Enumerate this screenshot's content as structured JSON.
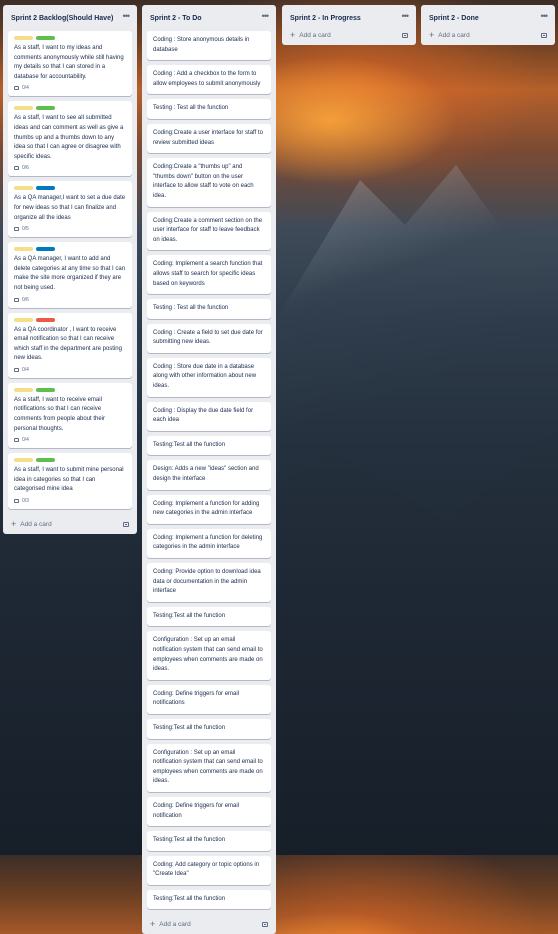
{
  "colors": {
    "label_yellow": "#f5dd8a",
    "label_green": "#61bd4f",
    "label_blue": "#0079bf",
    "label_red": "#eb5a46"
  },
  "lists": [
    {
      "title": "Sprint 2 Backlog(Should Have)",
      "add_card": "Add a card",
      "cards": [
        {
          "text": "As a staff, I want to my ideas and comments anonymously while still having my details so that I can stored in a database for accountability.",
          "labels": [
            "yellow",
            "green"
          ],
          "checklist": "0/4"
        },
        {
          "text": "As a staff, I want to see all submitted ideas and can comment as well as give a thumbs up and a thumbs down to any idea so that I can agree or disagree with specific ideas.",
          "labels": [
            "yellow",
            "green"
          ],
          "checklist": "0/6"
        },
        {
          "text": "As a QA manager,I want to set a due date for new ideas so that I can finalize and organize all the ideas",
          "labels": [
            "yellow",
            "blue"
          ],
          "checklist": "0/5"
        },
        {
          "text": "As a QA manager, I want to add and delete categories at any time so that I can make the site more organized if they are not being used.",
          "labels": [
            "yellow",
            "blue"
          ],
          "checklist": "0/6"
        },
        {
          "text": "As a QA coordinator , I want to receive email notification so that I can receive which staff in the department are posting new ideas.",
          "labels": [
            "yellow",
            "red"
          ],
          "checklist": "0/4"
        },
        {
          "text": "As a staff, I want to receive email notifications so that I can receive comments from people about their personal thoughts.",
          "labels": [
            "yellow",
            "green"
          ],
          "checklist": "0/4"
        },
        {
          "text": "As a staff, I want to submit mine personal idea in categories so that I can categorised mine idea",
          "labels": [
            "yellow",
            "green"
          ],
          "checklist": "0/3"
        }
      ]
    },
    {
      "title": "Sprint 2 - To Do",
      "add_card": "Add a card",
      "cards": [
        {
          "text": "Coding : Store anonymous details in database"
        },
        {
          "text": "Coding : Add a checkbox to the form to allow employees to submit anonymously"
        },
        {
          "text": "Testing : Test all the function"
        },
        {
          "text": "Coding:Create a user interface for staff to review submitted ideas"
        },
        {
          "text": "Coding:Create a \"thumbs up\" and \"thumbs down\" button on the user interface to allow staff to vote on each idea."
        },
        {
          "text": "Coding:Create a comment section on the user interface for staff to leave feedback on ideas."
        },
        {
          "text": "Coding: Implement a search function that allows staff to search for specific ideas based on keywords"
        },
        {
          "text": "Testing : Test all the function"
        },
        {
          "text": "Coding : Create a field to set due date for submitting new ideas."
        },
        {
          "text": "Coding : Store due date in a database along with other information about new ideas."
        },
        {
          "text": "Coding : Display the due date field for each idea"
        },
        {
          "text": "Testing:Test all the function"
        },
        {
          "text": "Design: Adds a new \"ideas\" section and design the interface"
        },
        {
          "text": "Coding: Implement a function for adding new categories in the admin interface"
        },
        {
          "text": "Coding: Implement a function for deleting categories in the admin interface"
        },
        {
          "text": "Coding: Provide option to download idea data or documentation in the admin interface"
        },
        {
          "text": "Testing:Test all the function"
        },
        {
          "text": "Configuration : Set up an email notification system that can send email to employees when comments are made on ideas."
        },
        {
          "text": "Coding: Define triggers for email notifications"
        },
        {
          "text": "Testing:Test all the function"
        },
        {
          "text": "Configuration : Set up an email notification system that can send email to employees when comments are made on ideas."
        },
        {
          "text": "Coding: Define triggers for email notification"
        },
        {
          "text": "Testing:Test all the function"
        },
        {
          "text": "Coding: Add category or topic options in \"Create Idea\""
        },
        {
          "text": "Testing:Test all the function"
        }
      ]
    },
    {
      "title": "Sprint 2 - In Progress",
      "add_card": "Add a card",
      "cards": []
    },
    {
      "title": "Sprint 2 - Done",
      "add_card": "Add a card",
      "cards": []
    }
  ]
}
